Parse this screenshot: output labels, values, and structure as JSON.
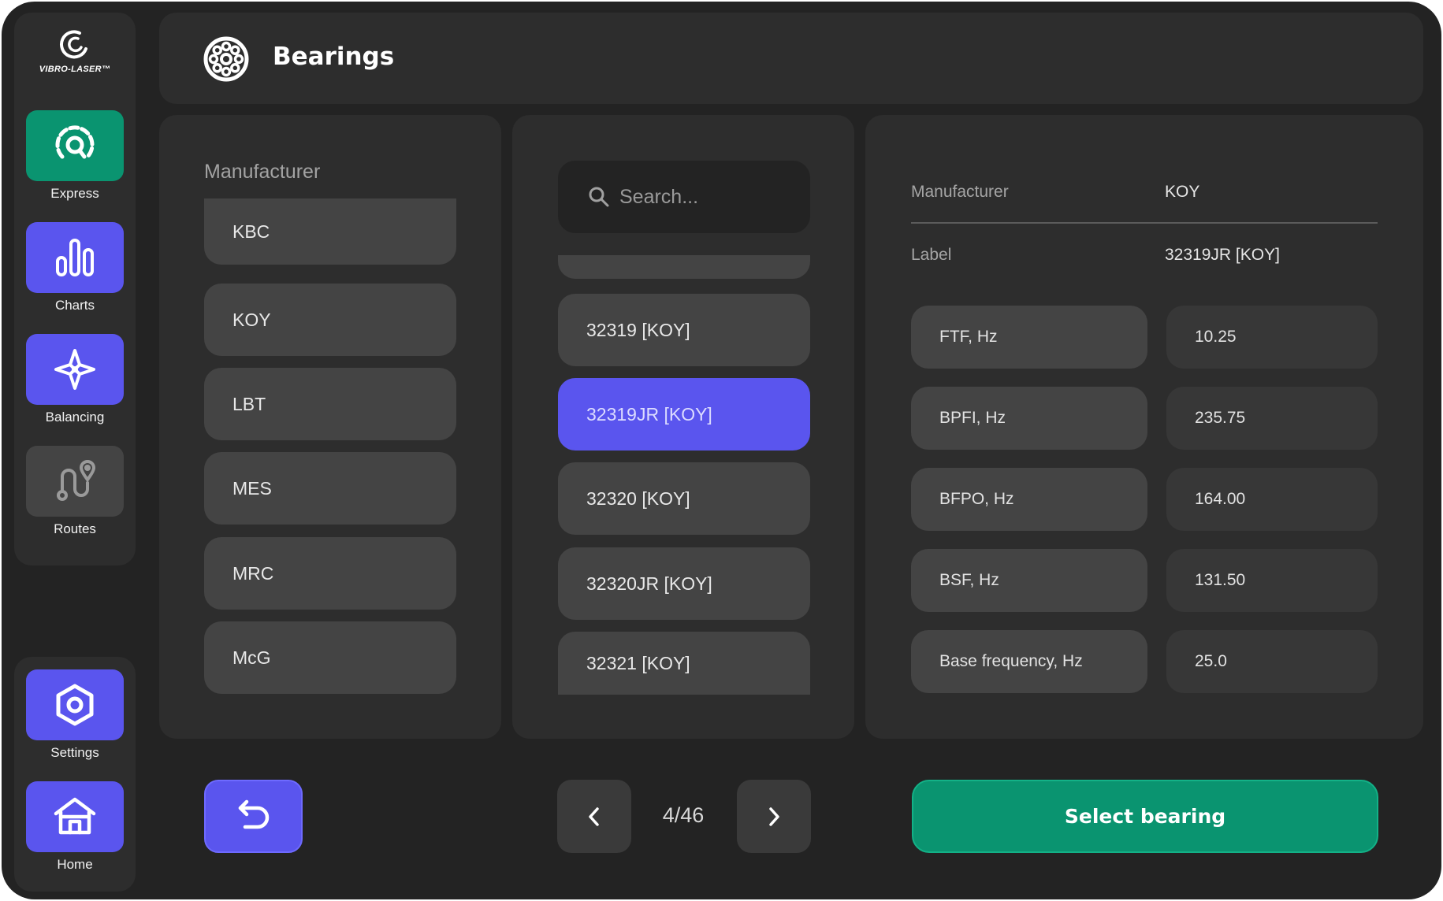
{
  "app": {
    "brand": "VIBRO-LASER™"
  },
  "header": {
    "title": "Bearings",
    "icon": "bearing-icon"
  },
  "sidebar": {
    "top_items": [
      {
        "label": "Express",
        "icon": "gauge-search-icon",
        "color": "#0a9470"
      },
      {
        "label": "Charts",
        "icon": "bar-chart-icon",
        "color": "#5a55ee"
      },
      {
        "label": "Balancing",
        "icon": "balancing-icon",
        "color": "#5a55ee"
      },
      {
        "label": "Routes",
        "icon": "route-icon",
        "color": "#444444"
      }
    ],
    "bottom_items": [
      {
        "label": "Settings",
        "icon": "settings-hex-icon"
      },
      {
        "label": "Home",
        "icon": "home-icon"
      }
    ]
  },
  "manufacturer_panel": {
    "title": "Manufacturer",
    "items": [
      "KBC",
      "KOY",
      "LBT",
      "MES",
      "MRC",
      "McG"
    ]
  },
  "bearing_list": {
    "search_placeholder": "Search...",
    "items": [
      "32319 [KOY]",
      "32319JR [KOY]",
      "32320 [KOY]",
      "32320JR [KOY]",
      "32321 [KOY]"
    ],
    "selected": "32319JR [KOY]"
  },
  "details": {
    "manufacturer_label": "Manufacturer",
    "manufacturer_value": "KOY",
    "label_label": "Label",
    "label_value": "32319JR [KOY]",
    "params": [
      {
        "name": "FTF, Hz",
        "value": "10.25"
      },
      {
        "name": "BPFI, Hz",
        "value": "235.75"
      },
      {
        "name": "BFPO, Hz",
        "value": "164.00"
      },
      {
        "name": "BSF, Hz",
        "value": "131.50"
      },
      {
        "name": "Base frequency, Hz",
        "value": "25.0"
      }
    ]
  },
  "pagination": {
    "text": "4/46"
  },
  "actions": {
    "select_label": "Select bearing"
  },
  "colors": {
    "accent_blue": "#5a55ee",
    "accent_green": "#0a9470",
    "background": "#232323",
    "panel": "#2d2d2d"
  }
}
